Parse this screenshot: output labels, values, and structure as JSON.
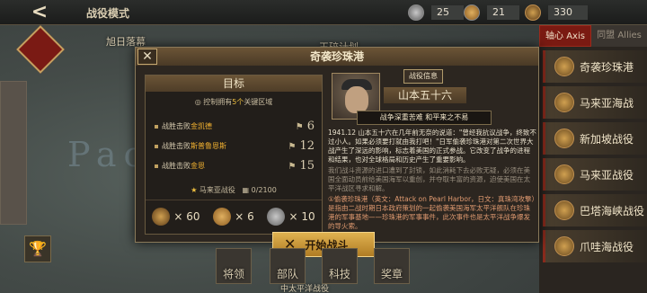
{
  "topbar": {
    "back_label": "<",
    "mode_title": "战役模式",
    "resources": [
      {
        "icon": "medal-silver-icon",
        "value": "25"
      },
      {
        "icon": "medal-gold-icon",
        "value": "21"
      },
      {
        "icon": "star-medal-icon",
        "value": "330"
      }
    ]
  },
  "map": {
    "ocean_label": "Pac",
    "labels": [
      "旭日落幕",
      "玉碎计划",
      "中太平洋战役"
    ]
  },
  "right_panel": {
    "tab_axis": "轴心 Axis",
    "tab_allies": "同盟 Allies",
    "battles": [
      "奇袭珍珠港",
      "马来亚海战",
      "新加坡战役",
      "马来亚战役",
      "巴塔海峡战役",
      "爪哇海战役"
    ]
  },
  "dialog": {
    "title": "奇袭珍珠港",
    "close_label": "✕",
    "objectives": {
      "header": "目标",
      "subtitle_pre": "控制拥有",
      "subtitle_hl": "5个",
      "subtitle_post": "关键区域",
      "rows": [
        {
          "pre": "战胜击败",
          "hl": "金凯德",
          "count": "6"
        },
        {
          "pre": "战胜击败",
          "hl": "斯普鲁恩斯",
          "count": "12"
        },
        {
          "pre": "战胜击败",
          "hl": "金恩",
          "count": "15"
        }
      ],
      "star_line": "马来亚战役",
      "progress": "0/2100",
      "rewards": [
        {
          "icon": "star-medal-icon",
          "value": "× 60"
        },
        {
          "icon": "medal-gold-icon",
          "value": "× 6"
        },
        {
          "icon": "medal-silver-icon",
          "value": "× 10"
        }
      ]
    },
    "commander": {
      "info_label": "战役信息",
      "name": "山本五十六",
      "motto": "战争深重苦难  和平来之不易",
      "desc": [
        "1941.12  山本五十六在几年前无奈的说道：\"曾经我抗议战争，终致不过小人。如果必须要打就由我打吧！\"日军偷袭珍珠港对第二次世界大战产生了深远的影响，标志着美国的正式参战。它改变了战争的进程和结果，也对全球格局和历史产生了重要影响。",
        "我们战斗资源的进口遭到了封锁，如此消耗下去必败无疑，必须在美国全面动员前给美国海军以重创，并夺取丰富的资源，迫使美国在太平洋战区寻求和解。",
        "①偷袭珍珠港（英文：Attack on Pearl Harbor，日文：真珠湾攻撃）是指由二战时期日本政府策划的一起偷袭美国海军太平洋舰队在珍珠港的军事基地——珍珠港的军事事件，此次事件也是太平洋战争爆发的导火索。"
      ]
    },
    "start_label": "开始战斗",
    "start_icon": "crossed-swords-icon"
  },
  "bottom_nav": [
    "将领",
    "部队",
    "科技",
    "奖章"
  ]
}
